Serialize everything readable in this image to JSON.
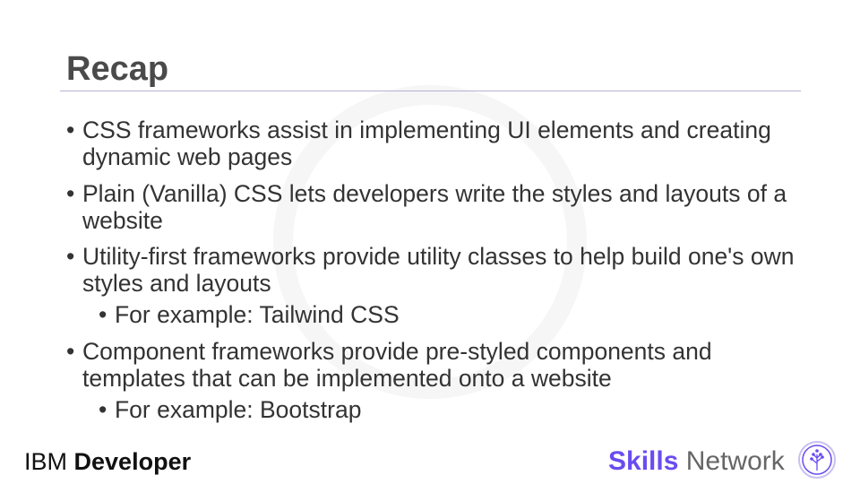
{
  "slide": {
    "title": "Recap",
    "bullets": [
      {
        "text": "CSS frameworks assist in implementing UI elements and creating dynamic web pages"
      },
      {
        "text": "Plain (Vanilla) CSS lets developers write the styles and layouts of a website"
      },
      {
        "text": "Utility-first frameworks provide utility classes to help build one's own styles and layouts",
        "sub": "For example: Tailwind CSS"
      },
      {
        "text": "Component frameworks provide pre-styled components and templates that can be implemented onto a website",
        "sub": "For example: Bootstrap"
      }
    ]
  },
  "footer": {
    "ibm_light": "IBM",
    "ibm_bold": "Developer",
    "skills": "Skills",
    "network": "Network"
  },
  "colors": {
    "accent": "#6a4cf0",
    "rule": "#b7b0d6"
  }
}
